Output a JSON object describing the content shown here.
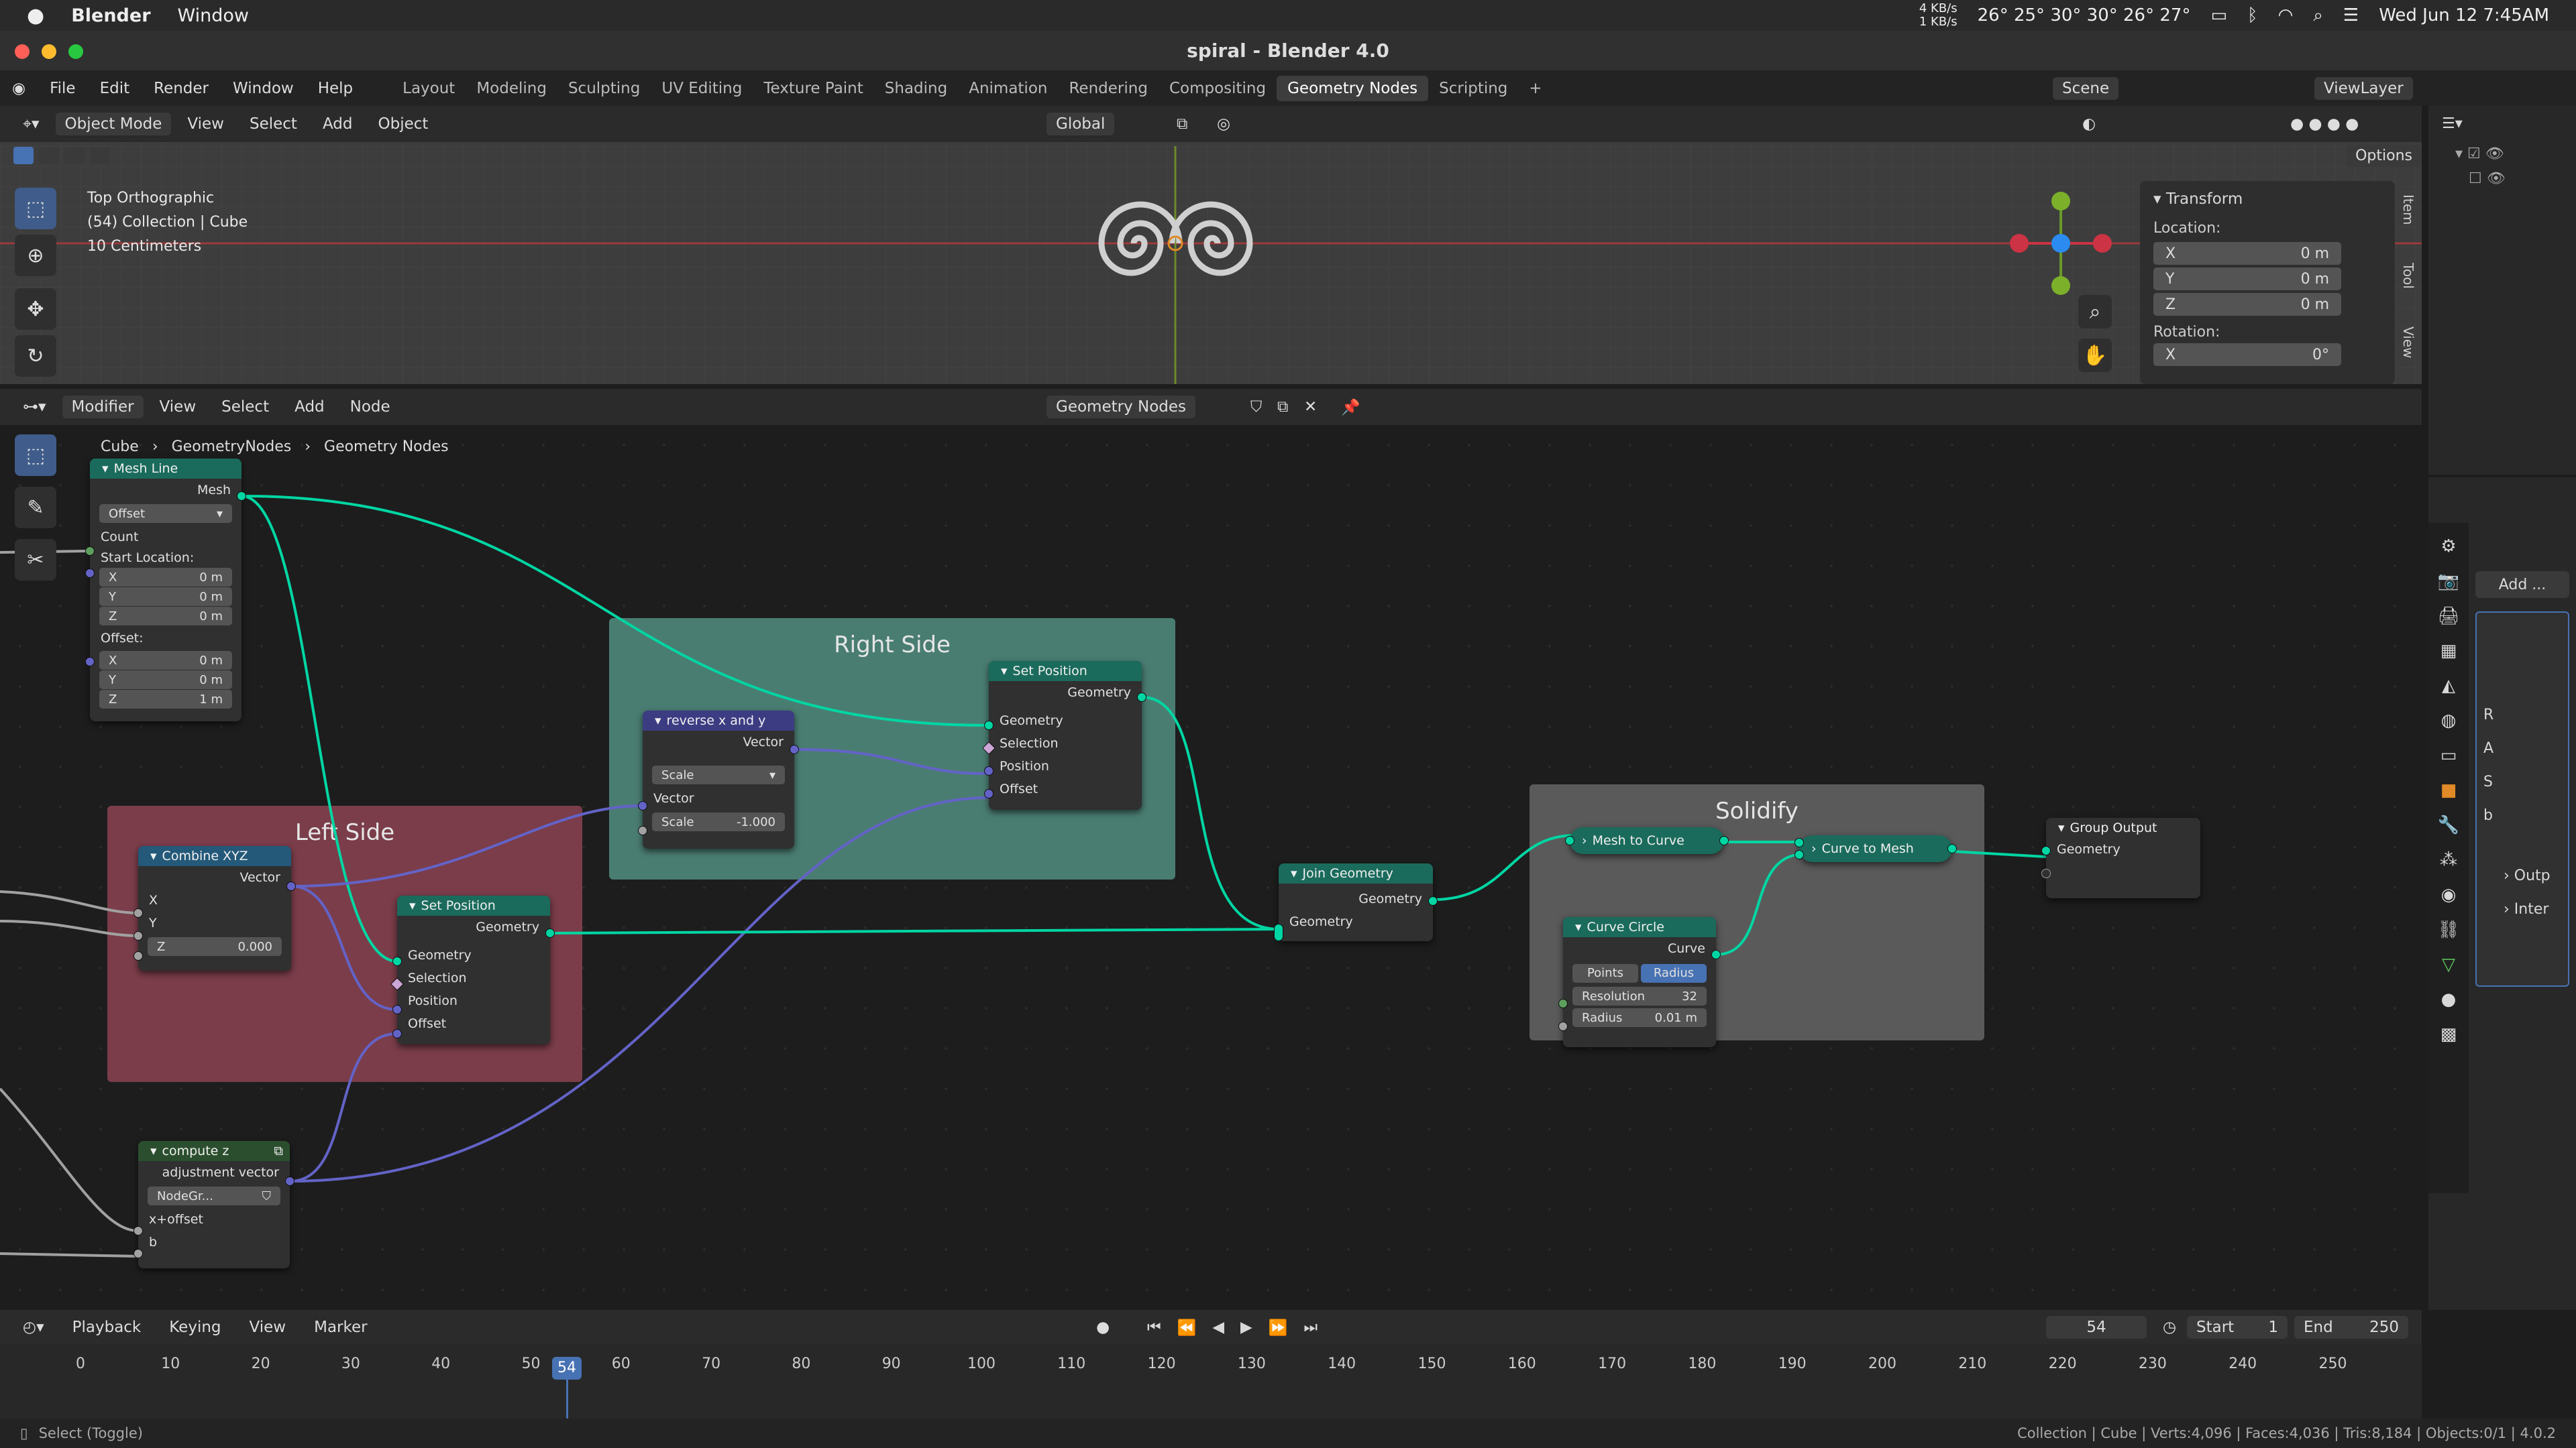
{
  "mac": {
    "app_name": "Blender",
    "menu_window": "Window",
    "net_up": "4 KB/s",
    "net_down": "1 KB/s",
    "temps": "26° 25° 30° 30° 26° 27°",
    "datetime": "Wed Jun 12  7:45AM"
  },
  "window": {
    "title": "spiral - Blender 4.0"
  },
  "menu": {
    "items": [
      "File",
      "Edit",
      "Render",
      "Window",
      "Help"
    ],
    "workspaces": [
      "Layout",
      "Modeling",
      "Sculpting",
      "UV Editing",
      "Texture Paint",
      "Shading",
      "Animation",
      "Rendering",
      "Compositing",
      "Geometry Nodes",
      "Scripting"
    ],
    "active_workspace": "Geometry Nodes",
    "scene": "Scene",
    "view_layer": "ViewLayer"
  },
  "viewport": {
    "mode": "Object Mode",
    "menus": [
      "View",
      "Select",
      "Add",
      "Object"
    ],
    "transform_orientation": "Global",
    "options": "Options",
    "info_line1": "Top Orthographic",
    "info_line2": "(54) Collection | Cube",
    "info_line3": "10 Centimeters",
    "tabs": [
      "Item",
      "Tool",
      "View"
    ]
  },
  "npanel": {
    "section": "Transform",
    "location_label": "Location:",
    "loc": [
      {
        "axis": "X",
        "value": "0 m"
      },
      {
        "axis": "Y",
        "value": "0 m"
      },
      {
        "axis": "Z",
        "value": "0 m"
      }
    ],
    "rotation_label": "Rotation:",
    "rot_x": {
      "axis": "X",
      "value": "0°"
    }
  },
  "node_editor": {
    "editor_type": "Modifier",
    "menus": [
      "View",
      "Select",
      "Add",
      "Node"
    ],
    "tree_name": "Geometry Nodes",
    "breadcrumb": [
      "Cube",
      "GeometryNodes",
      "Geometry Nodes"
    ]
  },
  "frames": {
    "right": "Right Side",
    "left": "Left Side",
    "solidify": "Solidify"
  },
  "nodes": {
    "mesh_line": {
      "title": "Mesh Line",
      "out": "Mesh",
      "mode": "Offset",
      "count": "Count",
      "start_label": "Start Location:",
      "start": [
        {
          "axis": "X",
          "value": "0 m"
        },
        {
          "axis": "Y",
          "value": "0 m"
        },
        {
          "axis": "Z",
          "value": "0 m"
        }
      ],
      "offset_label": "Offset:",
      "offset": [
        {
          "axis": "X",
          "value": "0 m"
        },
        {
          "axis": "Y",
          "value": "0 m"
        },
        {
          "axis": "Z",
          "value": "1 m"
        }
      ]
    },
    "reverse": {
      "title": "reverse x and y",
      "out": "Vector",
      "mode": "Scale",
      "in": "Vector",
      "scale_label": "Scale",
      "scale_value": "-1.000"
    },
    "set_pos_r": {
      "title": "Set Position",
      "out": "Geometry",
      "in": [
        "Geometry",
        "Selection",
        "Position",
        "Offset"
      ]
    },
    "combine": {
      "title": "Combine XYZ",
      "out": "Vector",
      "x": "X",
      "y": "Y",
      "z_label": "Z",
      "z_value": "0.000"
    },
    "set_pos_l": {
      "title": "Set Position",
      "out": "Geometry",
      "in": [
        "Geometry",
        "Selection",
        "Position",
        "Offset"
      ]
    },
    "join": {
      "title": "Join Geometry",
      "out": "Geometry",
      "in": "Geometry"
    },
    "mesh_to_curve": {
      "title": "Mesh to Curve"
    },
    "curve_to_mesh": {
      "title": "Curve to Mesh"
    },
    "curve_circle": {
      "title": "Curve Circle",
      "out": "Curve",
      "mode_a": "Points",
      "mode_b": "Radius",
      "res_label": "Resolution",
      "res_value": "32",
      "rad_label": "Radius",
      "rad_value": "0.01 m"
    },
    "group_output": {
      "title": "Group Output",
      "in": "Geometry"
    },
    "compute_z": {
      "title": "compute z",
      "out": "adjustment vector",
      "group": "NodeGr...",
      "in1": "x+offset",
      "in2": "b"
    }
  },
  "props": {
    "add_modifier": "Add ...",
    "rows": [
      "R",
      "A",
      "S",
      "b"
    ],
    "outp": "Outp",
    "inter": "Inter"
  },
  "timeline": {
    "menus": [
      "Playback",
      "Keying",
      "View",
      "Marker"
    ],
    "current_frame": "54",
    "start_label": "Start",
    "start": "1",
    "end_label": "End",
    "end": "250",
    "ticks": [
      "0",
      "10",
      "20",
      "30",
      "40",
      "50",
      "60",
      "70",
      "80",
      "90",
      "100",
      "110",
      "120",
      "130",
      "140",
      "150",
      "160",
      "170",
      "180",
      "190",
      "200",
      "210",
      "220",
      "230",
      "240",
      "250"
    ]
  },
  "status": {
    "left": "Select (Toggle)",
    "right": "Collection | Cube | Verts:4,096 | Faces:4,036 | Tris:8,184 | Objects:0/1 | 4.0.2"
  }
}
